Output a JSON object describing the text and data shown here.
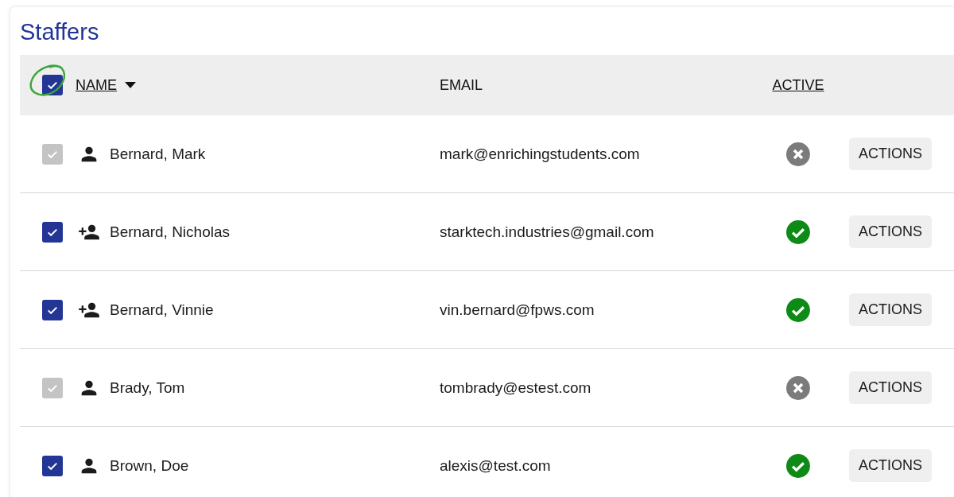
{
  "title": "Staffers",
  "header": {
    "select_all": {
      "checked": true
    },
    "columns": [
      {
        "label": "NAME",
        "sortable": true,
        "sorted": true
      },
      {
        "label": "EMAIL",
        "sortable": false
      },
      {
        "label": "ACTIVE",
        "sortable": true
      }
    ]
  },
  "rows": [
    {
      "checked": true,
      "disabled": true,
      "kind": "person",
      "name": "Bernard, Mark",
      "email": "mark@enrichingstudents.com",
      "active": false,
      "action": "ACTIONS"
    },
    {
      "checked": true,
      "disabled": false,
      "kind": "person-add",
      "name": "Bernard, Nicholas",
      "email": "starktech.industries@gmail.com",
      "active": true,
      "action": "ACTIONS"
    },
    {
      "checked": true,
      "disabled": false,
      "kind": "person-add",
      "name": "Bernard, Vinnie",
      "email": "vin.bernard@fpws.com",
      "active": true,
      "action": "ACTIONS"
    },
    {
      "checked": true,
      "disabled": true,
      "kind": "person",
      "name": "Brady, Tom",
      "email": "tombrady@estest.com",
      "active": false,
      "action": "ACTIONS"
    },
    {
      "checked": true,
      "disabled": false,
      "kind": "person",
      "name": "Brown, Doe",
      "email": "alexis@test.com",
      "active": true,
      "action": "ACTIONS"
    }
  ]
}
